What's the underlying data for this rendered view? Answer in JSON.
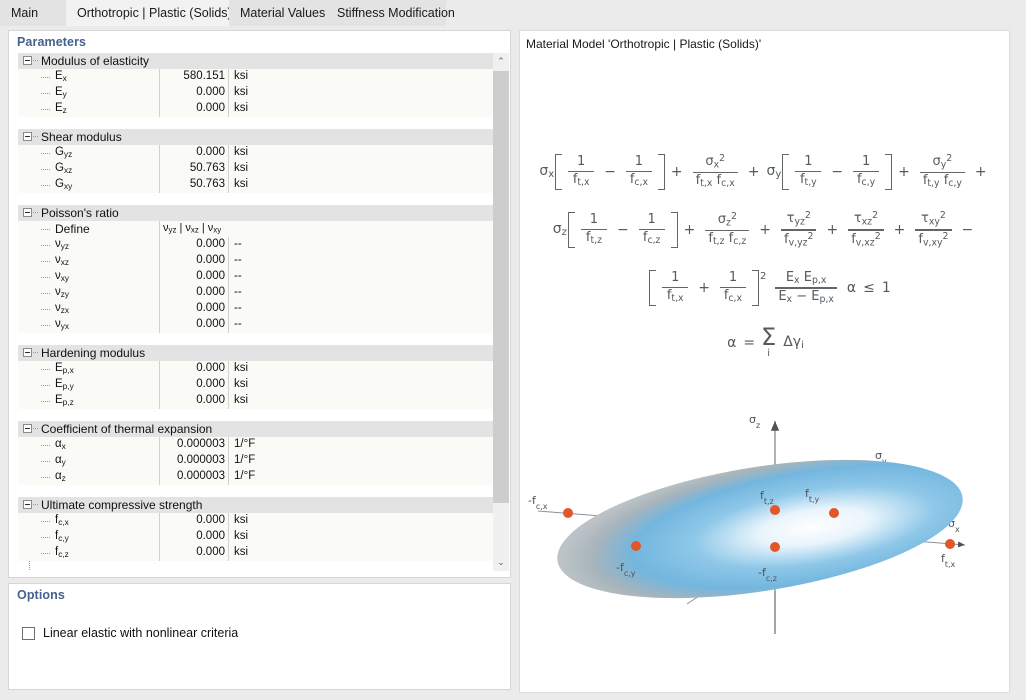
{
  "tabs": [
    {
      "label": "Main",
      "active": false
    },
    {
      "label": "Orthotropic | Plastic (Solids)",
      "active": true
    },
    {
      "label": "Material Values",
      "active": false
    },
    {
      "label": "Stiffness Modification",
      "active": false
    }
  ],
  "parameters_panel": {
    "title": "Parameters",
    "scrollbar": {
      "up_arrow": "⌃",
      "down_arrow": "⌄"
    },
    "groups": [
      {
        "name": "Modulus of elasticity",
        "rows": [
          {
            "label_html": "E<sub>x</sub>",
            "value": "580.151",
            "unit": "ksi"
          },
          {
            "label_html": "E<sub>y</sub>",
            "value": "0.000",
            "unit": "ksi"
          },
          {
            "label_html": "E<sub>z</sub>",
            "value": "0.000",
            "unit": "ksi"
          }
        ]
      },
      {
        "name": "Shear modulus",
        "rows": [
          {
            "label_html": "G<sub>yz</sub>",
            "value": "0.000",
            "unit": "ksi"
          },
          {
            "label_html": "G<sub>xz</sub>",
            "value": "50.763",
            "unit": "ksi"
          },
          {
            "label_html": "G<sub>xy</sub>",
            "value": "50.763",
            "unit": "ksi"
          }
        ]
      },
      {
        "name": "Poisson's ratio",
        "rows": [
          {
            "label_html": "Define",
            "define": "ν<sub>yz</sub> | ν<sub>xz</sub> | ν<sub>xy</sub>"
          },
          {
            "label_html": "ν<sub>yz</sub>",
            "value": "0.000",
            "unit": "--"
          },
          {
            "label_html": "ν<sub>xz</sub>",
            "value": "0.000",
            "unit": "--"
          },
          {
            "label_html": "ν<sub>xy</sub>",
            "value": "0.000",
            "unit": "--"
          },
          {
            "label_html": "ν<sub>zy</sub>",
            "value": "0.000",
            "unit": "--"
          },
          {
            "label_html": "ν<sub>zx</sub>",
            "value": "0.000",
            "unit": "--"
          },
          {
            "label_html": "ν<sub>yx</sub>",
            "value": "0.000",
            "unit": "--"
          }
        ]
      },
      {
        "name": "Hardening modulus",
        "rows": [
          {
            "label_html": "E<sub>p,x</sub>",
            "value": "0.000",
            "unit": "ksi"
          },
          {
            "label_html": "E<sub>p,y</sub>",
            "value": "0.000",
            "unit": "ksi"
          },
          {
            "label_html": "E<sub>p,z</sub>",
            "value": "0.000",
            "unit": "ksi"
          }
        ]
      },
      {
        "name": "Coefficient of thermal expansion",
        "rows": [
          {
            "label_html": "α<sub>x</sub>",
            "value": "0.000003",
            "unit": "1/°F"
          },
          {
            "label_html": "α<sub>y</sub>",
            "value": "0.000003",
            "unit": "1/°F"
          },
          {
            "label_html": "α<sub>z</sub>",
            "value": "0.000003",
            "unit": "1/°F"
          }
        ]
      },
      {
        "name": "Ultimate compressive strength",
        "rows": [
          {
            "label_html": "f<sub>c,x</sub>",
            "value": "0.000",
            "unit": "ksi"
          },
          {
            "label_html": "f<sub>c,y</sub>",
            "value": "0.000",
            "unit": "ksi"
          },
          {
            "label_html": "f<sub>c,z</sub>",
            "value": "0.000",
            "unit": "ksi"
          }
        ]
      }
    ]
  },
  "options_panel": {
    "title": "Options",
    "checkbox": {
      "label": "Linear elastic with nonlinear criteria",
      "checked": false
    }
  },
  "right_panel": {
    "title": "Material Model 'Orthotropic | Plastic (Solids)'",
    "formula_lines": [
      "σx [ 1/ft,x − 1/fc,x ] + σx²/(ft,x fc,x) + σy [ 1/ft,y − 1/fc,y ] + σy²/(ft,y fc,y) +",
      "σz [ 1/ft,z − 1/fc,z ] + σz²/(ft,z fc,z) + τyz²/fv,yz² + τxz²/fv,xz² + τxy²/fv,xy² −",
      "[ 1/ft,x + 1/fc,x ]² (Ex Ep,x)/(Ex − Ep,x) α ≤ 1",
      "α = Σi Δγi"
    ],
    "diagram": {
      "axis_labels": {
        "z": "σz",
        "y": "σy",
        "x": "σx"
      },
      "point_labels": {
        "neg_fc_x": "-fс,x",
        "ft_z": "fₜ,z",
        "ft_y": "fₜ,y",
        "ft_x": "fₜ,x",
        "neg_fc_y": "-fс,y",
        "neg_fc_z": "-fс,z"
      },
      "colors": {
        "point": "#e2562a",
        "surface_light": "#ffffff",
        "surface_blue": "#66b2e0",
        "surface_gray": "#b5bcc1",
        "axis": "#6d7478"
      }
    }
  }
}
